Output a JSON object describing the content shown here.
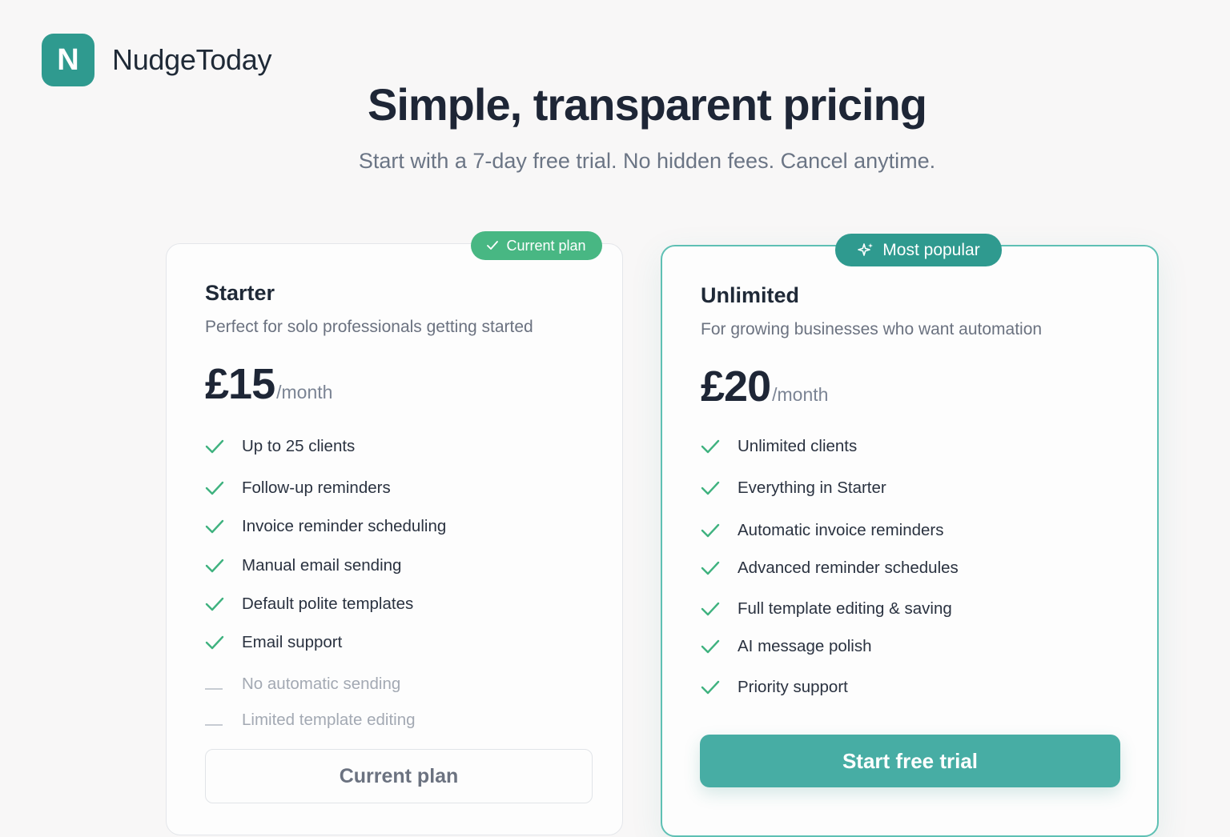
{
  "brand": {
    "logo_letter": "N",
    "name": "NudgeToday"
  },
  "hero": {
    "title": "Simple, transparent pricing",
    "subtitle": "Start with a 7-day free trial. No hidden fees. Cancel anytime."
  },
  "plans": [
    {
      "badge": "Current plan",
      "badge_icon": "check-icon",
      "badge_color": "#48b783",
      "name": "Starter",
      "description": "Perfect for solo professionals getting started",
      "price": "£15",
      "period": "/month",
      "features": [
        {
          "text": "Up to 25 clients",
          "included": true
        },
        {
          "text": "Follow-up reminders",
          "included": true
        },
        {
          "text": "Invoice reminder scheduling",
          "included": true
        },
        {
          "text": "Manual email sending",
          "included": true
        },
        {
          "text": "Default polite templates",
          "included": true
        },
        {
          "text": "Email support",
          "included": true
        },
        {
          "text": "No automatic sending",
          "included": false
        },
        {
          "text": "Limited template editing",
          "included": false
        }
      ],
      "button": "Current plan"
    },
    {
      "badge": "Most popular",
      "badge_icon": "sparkle-icon",
      "badge_color": "#2f9a8f",
      "name": "Unlimited",
      "description": "For growing businesses who want automation",
      "price": "£20",
      "period": "/month",
      "features": [
        {
          "text": "Unlimited clients",
          "included": true
        },
        {
          "text": "Everything in Starter",
          "included": true
        },
        {
          "text": "Automatic invoice reminders",
          "included": true
        },
        {
          "text": "Advanced reminder schedules",
          "included": true
        },
        {
          "text": "Full template editing & saving",
          "included": true
        },
        {
          "text": "AI message polish",
          "included": true
        },
        {
          "text": "Priority support",
          "included": true
        }
      ],
      "button": "Start free trial"
    }
  ],
  "colors": {
    "accent": "#2f9a8f",
    "check": "#3fb27f",
    "button": "#47ada4"
  }
}
